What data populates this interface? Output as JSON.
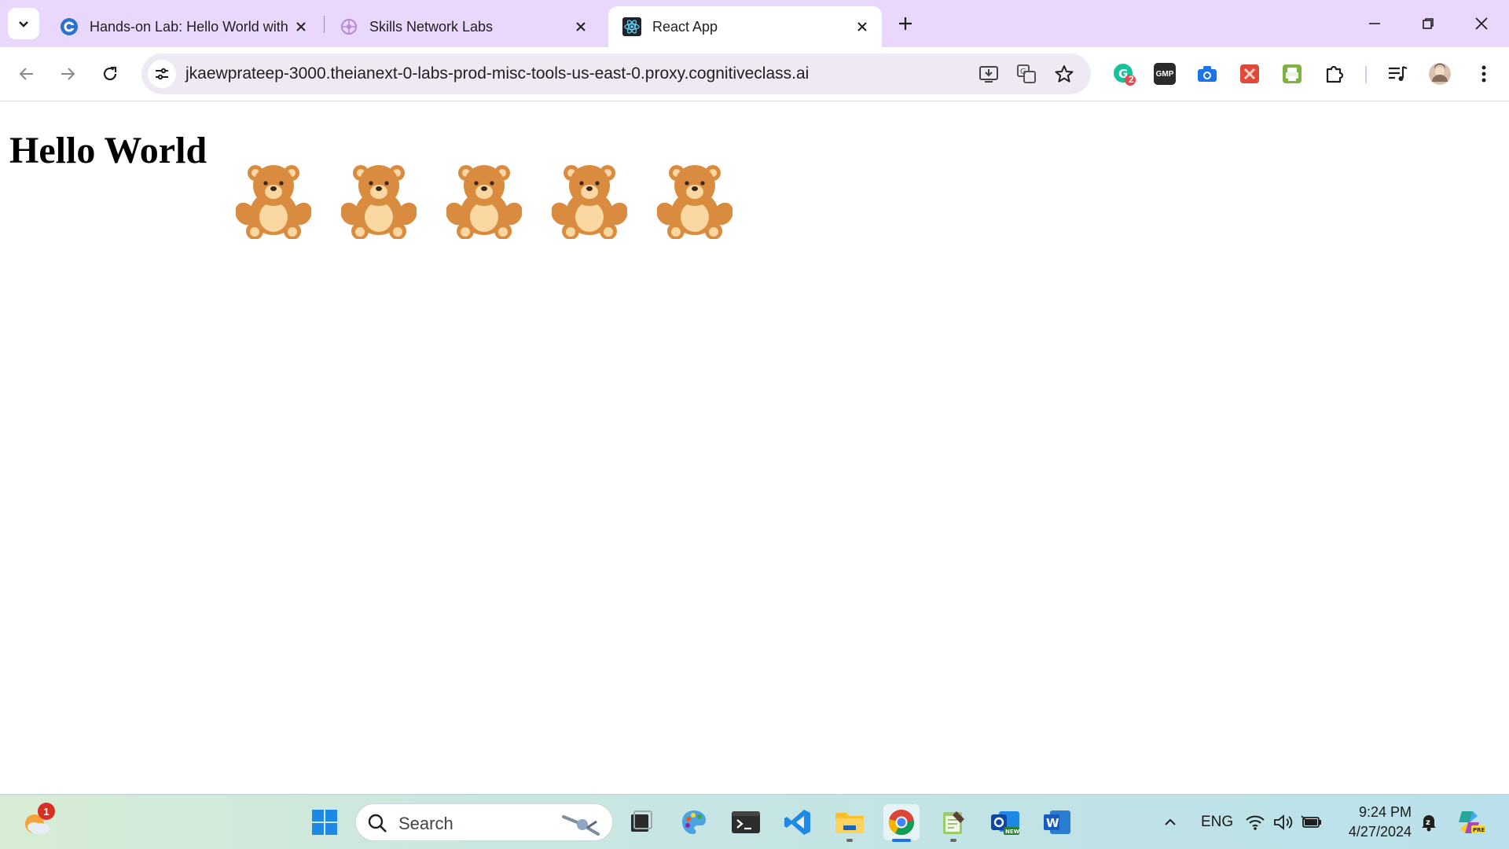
{
  "browser": {
    "tabs": [
      {
        "title": "Hands-on Lab: Hello World with",
        "icon": "coursera-icon",
        "active": false
      },
      {
        "title": "Skills Network Labs",
        "icon": "skills-network-icon",
        "active": false
      },
      {
        "title": "React App",
        "icon": "react-icon",
        "active": true
      }
    ],
    "url": "jkaewprateep-3000.theianext-0-labs-prod-misc-tools-us-east-0.proxy.cognitiveclass.ai",
    "extensions": [
      "grammarly-icon",
      "gmp-icon",
      "camera-icon",
      "extension-red-icon",
      "printer-icon",
      "puzzle-icon",
      "media-control-icon",
      "profile-avatar"
    ],
    "extension_badge": "2",
    "gmp_label": "GMP"
  },
  "page": {
    "heading": "Hello World",
    "bears": [
      "teddy-bear",
      "teddy-bear",
      "teddy-bear",
      "teddy-bear",
      "teddy-bear"
    ]
  },
  "taskbar": {
    "weather_badge": "1",
    "search_placeholder": "Search",
    "pinned": [
      "start-icon",
      "search",
      "task-view-icon",
      "paint-icon",
      "terminal-icon",
      "vscode-icon",
      "file-explorer-icon",
      "chrome-icon",
      "notepad-icon",
      "outlook-icon",
      "word-icon"
    ],
    "tray": {
      "language": "ENG",
      "time": "9:24 PM",
      "date": "4/27/2024"
    }
  },
  "colors": {
    "tabstrip": "#e9d8fb",
    "omnibox": "#efe9f4",
    "bear_body": "#d98c3f",
    "bear_belly": "#fbd7a1"
  }
}
